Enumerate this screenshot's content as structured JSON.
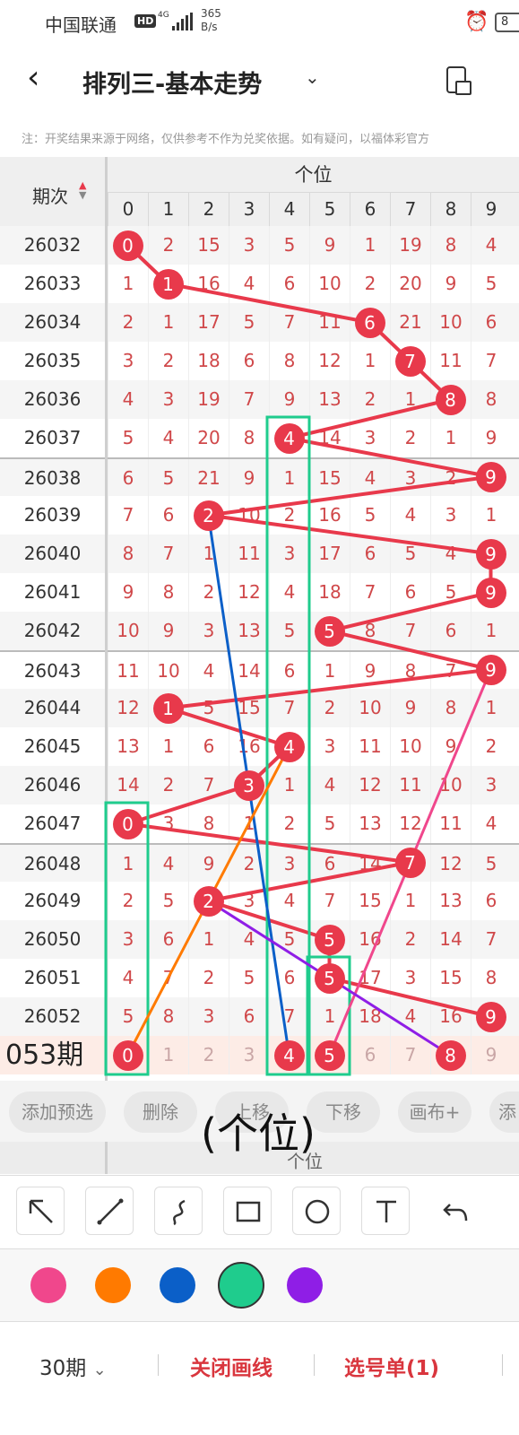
{
  "status": {
    "carrier": "中国联通",
    "hd": "HD",
    "net": "4G",
    "speed_value": "365",
    "speed_unit": "B/s",
    "battery": "8"
  },
  "header": {
    "title": "排列三-基本走势"
  },
  "notice": "注：开奖结果来源于网络，仅供参考不作为兑奖依据。如有疑问，以福体彩官方",
  "table": {
    "period_header": "期次",
    "group_header": "个位",
    "digits": [
      "0",
      "1",
      "2",
      "3",
      "4",
      "5",
      "6",
      "7",
      "8",
      "9"
    ],
    "rows": [
      {
        "period": "26032",
        "cells": [
          "0",
          "2",
          "15",
          "3",
          "5",
          "9",
          "1",
          "19",
          "8",
          "4"
        ],
        "hit": 0
      },
      {
        "period": "26033",
        "cells": [
          "1",
          "1",
          "16",
          "4",
          "6",
          "10",
          "2",
          "20",
          "9",
          "5"
        ],
        "hit": 1
      },
      {
        "period": "26034",
        "cells": [
          "2",
          "1",
          "17",
          "5",
          "7",
          "11",
          "6",
          "21",
          "10",
          "6"
        ],
        "hit": 6
      },
      {
        "period": "26035",
        "cells": [
          "3",
          "2",
          "18",
          "6",
          "8",
          "12",
          "1",
          "7",
          "11",
          "7"
        ],
        "hit": 7
      },
      {
        "period": "26036",
        "cells": [
          "4",
          "3",
          "19",
          "7",
          "9",
          "13",
          "2",
          "1",
          "8",
          "8"
        ],
        "hit": 8
      },
      {
        "period": "26037",
        "cells": [
          "5",
          "4",
          "20",
          "8",
          "4",
          "14",
          "3",
          "2",
          "1",
          "9"
        ],
        "hit": 4
      },
      {
        "period": "26038",
        "cells": [
          "6",
          "5",
          "21",
          "9",
          "1",
          "15",
          "4",
          "3",
          "2",
          "9"
        ],
        "hit": 9
      },
      {
        "period": "26039",
        "cells": [
          "7",
          "6",
          "2",
          "10",
          "2",
          "16",
          "5",
          "4",
          "3",
          "1"
        ],
        "hit": 2
      },
      {
        "period": "26040",
        "cells": [
          "8",
          "7",
          "1",
          "11",
          "3",
          "17",
          "6",
          "5",
          "4",
          "9"
        ],
        "hit": 9
      },
      {
        "period": "26041",
        "cells": [
          "9",
          "8",
          "2",
          "12",
          "4",
          "18",
          "7",
          "6",
          "5",
          "9"
        ],
        "hit": 9
      },
      {
        "period": "26042",
        "cells": [
          "10",
          "9",
          "3",
          "13",
          "5",
          "5",
          "8",
          "7",
          "6",
          "1"
        ],
        "hit": 5
      },
      {
        "period": "26043",
        "cells": [
          "11",
          "10",
          "4",
          "14",
          "6",
          "1",
          "9",
          "8",
          "7",
          "9"
        ],
        "hit": 9
      },
      {
        "period": "26044",
        "cells": [
          "12",
          "1",
          "5",
          "15",
          "7",
          "2",
          "10",
          "9",
          "8",
          "1"
        ],
        "hit": 1
      },
      {
        "period": "26045",
        "cells": [
          "13",
          "1",
          "6",
          "16",
          "4",
          "3",
          "11",
          "10",
          "9",
          "2"
        ],
        "hit": 4
      },
      {
        "period": "26046",
        "cells": [
          "14",
          "2",
          "7",
          "3",
          "1",
          "4",
          "12",
          "11",
          "10",
          "3"
        ],
        "hit": 3
      },
      {
        "period": "26047",
        "cells": [
          "0",
          "3",
          "8",
          "1",
          "2",
          "5",
          "13",
          "12",
          "11",
          "4"
        ],
        "hit": 0
      },
      {
        "period": "26048",
        "cells": [
          "1",
          "4",
          "9",
          "2",
          "3",
          "6",
          "14",
          "7",
          "12",
          "5"
        ],
        "hit": 7
      },
      {
        "period": "26049",
        "cells": [
          "2",
          "5",
          "2",
          "3",
          "4",
          "7",
          "15",
          "1",
          "13",
          "6"
        ],
        "hit": 2
      },
      {
        "period": "26050",
        "cells": [
          "3",
          "6",
          "1",
          "4",
          "5",
          "5",
          "16",
          "2",
          "14",
          "7"
        ],
        "hit": 5
      },
      {
        "period": "26051",
        "cells": [
          "4",
          "7",
          "2",
          "5",
          "6",
          "5",
          "17",
          "3",
          "15",
          "8"
        ],
        "hit": 5
      },
      {
        "period": "26052",
        "cells": [
          "5",
          "8",
          "3",
          "6",
          "7",
          "1",
          "18",
          "4",
          "16",
          "9"
        ],
        "hit": 9
      }
    ],
    "current": {
      "period": "053期",
      "cells": [
        "0",
        "1",
        "2",
        "3",
        "4",
        "5",
        "6",
        "7",
        "8",
        "9"
      ],
      "balls": [
        0,
        4,
        5,
        8
      ]
    }
  },
  "actions": [
    "添加预选",
    "删除",
    "上移",
    "下移",
    "画布+",
    "添"
  ],
  "overlay_caption": "(个位)",
  "ghost_header": "个位",
  "tools": [
    "arrow-icon",
    "line-icon",
    "curve-icon",
    "rectangle-icon",
    "circle-icon",
    "text-icon",
    "undo-icon"
  ],
  "colors": {
    "pink": "#f0478c",
    "orange": "#ff7a00",
    "blue": "#0b5fc8",
    "green": "#1fcc8d",
    "purple": "#8f1ee6",
    "ball": "#e8394b",
    "line": "#e8394b"
  },
  "bottom": {
    "periods": "30期",
    "close_draw": "关闭画线",
    "selection": "选号单(1)"
  }
}
